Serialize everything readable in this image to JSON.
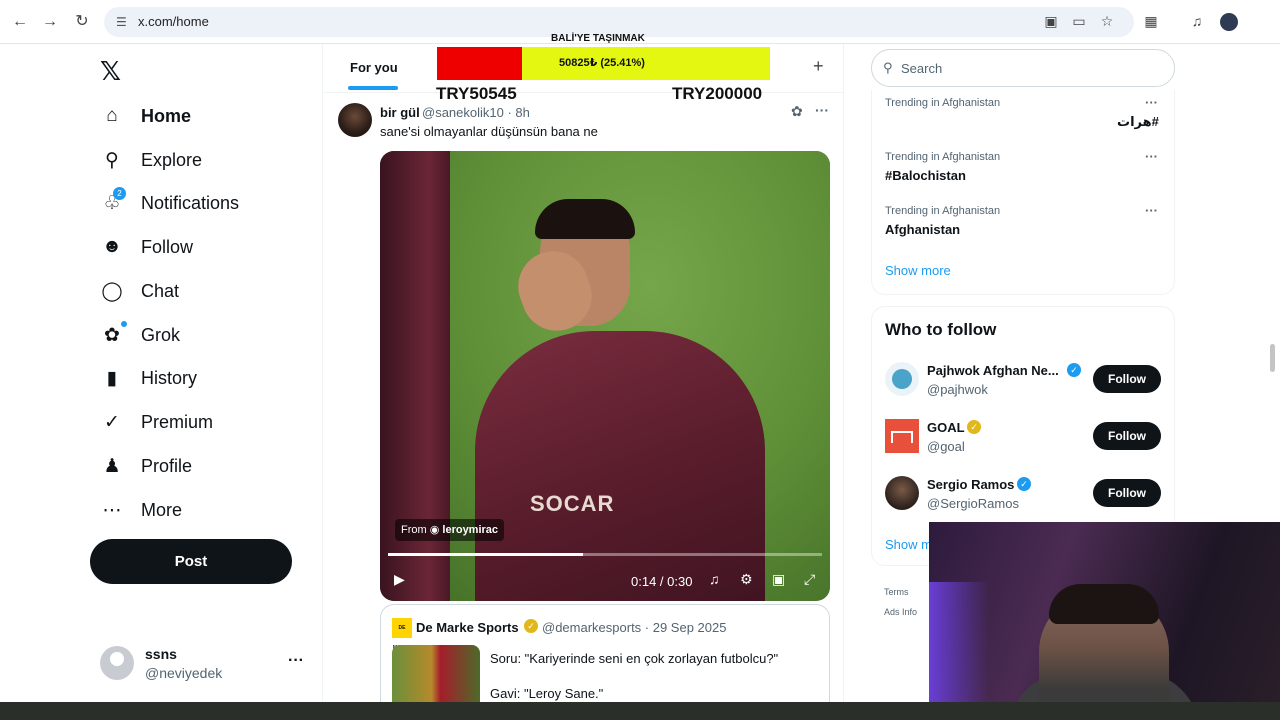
{
  "browser": {
    "url": "x.com/home"
  },
  "sidebar": {
    "items": [
      {
        "label": "Home",
        "icon": "home-icon"
      },
      {
        "label": "Explore",
        "icon": "search-icon"
      },
      {
        "label": "Notifications",
        "icon": "bell-icon",
        "badge": "2"
      },
      {
        "label": "Follow",
        "icon": "person-add-icon"
      },
      {
        "label": "Chat",
        "icon": "chat-icon"
      },
      {
        "label": "Grok",
        "icon": "grok-icon"
      },
      {
        "label": "History",
        "icon": "bookmark-icon"
      },
      {
        "label": "Premium",
        "icon": "verified-icon"
      },
      {
        "label": "Profile",
        "icon": "person-icon"
      },
      {
        "label": "More",
        "icon": "more-circle-icon"
      }
    ],
    "post_label": "Post",
    "account": {
      "name": "ssns",
      "handle": "@neviyedek"
    }
  },
  "feed": {
    "tab_label": "For you",
    "tweet": {
      "name": "bir gül",
      "handle": "@sanekolik10 · 8h",
      "text": "sane'si olmayanlar düşünsün bana ne",
      "video": {
        "sponsor": "SOCAR",
        "from_prefix": "From",
        "from_user": "leroymirac",
        "time": "0:14 / 0:30",
        "progress": 0.45
      },
      "quote": {
        "logo_text": "DE MARKE",
        "name": "De Marke Sports",
        "handle": "@demarkesports · 29 Sep 2025",
        "line1": "Soru: \"Kariyerinde seni en çok zorlayan futbolcu?\"",
        "line2": "Gavi: \"Leroy Sane.\""
      }
    }
  },
  "overlay_banner": {
    "title": "BALİ'YE TAŞINMAK",
    "percent_label": "50825₺ (25.41%)",
    "left_label": "TRY50545",
    "right_label": "TRY200000",
    "colors": {
      "filled": "#ee0000",
      "remaining": "#e4f710"
    }
  },
  "right": {
    "search_placeholder": "Search",
    "trends": [
      {
        "meta": "Trending in Afghanistan",
        "name": "#هرات"
      },
      {
        "meta": "Trending in Afghanistan",
        "name": "#Balochistan"
      },
      {
        "meta": "Trending in Afghanistan",
        "name": "Afghanistan"
      }
    ],
    "show_more": "Show more",
    "who_to_follow": {
      "title": "Who to follow",
      "accounts": [
        {
          "name": "Pajhwok Afghan Ne...",
          "handle": "@pajhwok",
          "verified": "blue"
        },
        {
          "name": "GOAL",
          "handle": "@goal",
          "verified": "gold"
        },
        {
          "name": "Sergio Ramos",
          "handle": "@SergioRamos",
          "verified": "blue"
        }
      ],
      "follow_label": "Follow",
      "show_more": "Show m"
    },
    "footer": {
      "terms": "Terms",
      "ads": "Ads Info"
    }
  },
  "colors": {
    "accent": "#1d9bf0",
    "text": "#0f1419",
    "muted": "#536471"
  }
}
